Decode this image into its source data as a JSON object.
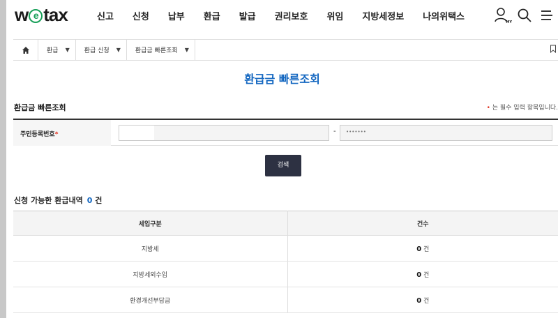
{
  "header": {
    "logo": {
      "pre": "w",
      "mid": "e",
      "post": "tax"
    },
    "nav": [
      "신고",
      "신청",
      "납부",
      "환급",
      "발급",
      "권리보호",
      "위임",
      "지방세정보",
      "나의위택스"
    ],
    "icons": [
      "my-user-icon",
      "search-icon",
      "menu-icon"
    ],
    "my_label": "MY"
  },
  "breadcrumb": {
    "items": [
      "환급",
      "환급 신청",
      "환급금 빠른조회"
    ],
    "icons": [
      "home-icon",
      "bookmark-icon"
    ]
  },
  "page_title": "환급금 빠른조회",
  "section": {
    "title": "환급금 빠른조회",
    "required_note_mark": "•",
    "required_note": "는 필수 입력 항목입니다."
  },
  "form": {
    "rrn_label": "주민등록번호",
    "required_mark": "*",
    "first_value": "",
    "separator": "-",
    "second_value": "•••••••",
    "search_button": "검색"
  },
  "results": {
    "title": "신청 가능한 환급내역",
    "count": "0",
    "count_unit": "건",
    "columns": [
      "세입구분",
      "건수"
    ],
    "rows": [
      {
        "type": "지방세",
        "count": "0",
        "unit": "건"
      },
      {
        "type": "지방세외수입",
        "count": "0",
        "unit": "건"
      },
      {
        "type": "환경개선부담금",
        "count": "0",
        "unit": "건"
      }
    ]
  },
  "colors": {
    "accent": "#1266c0",
    "logo_green": "#1aa05a",
    "button": "#2d3142",
    "required": "#e0301e"
  }
}
